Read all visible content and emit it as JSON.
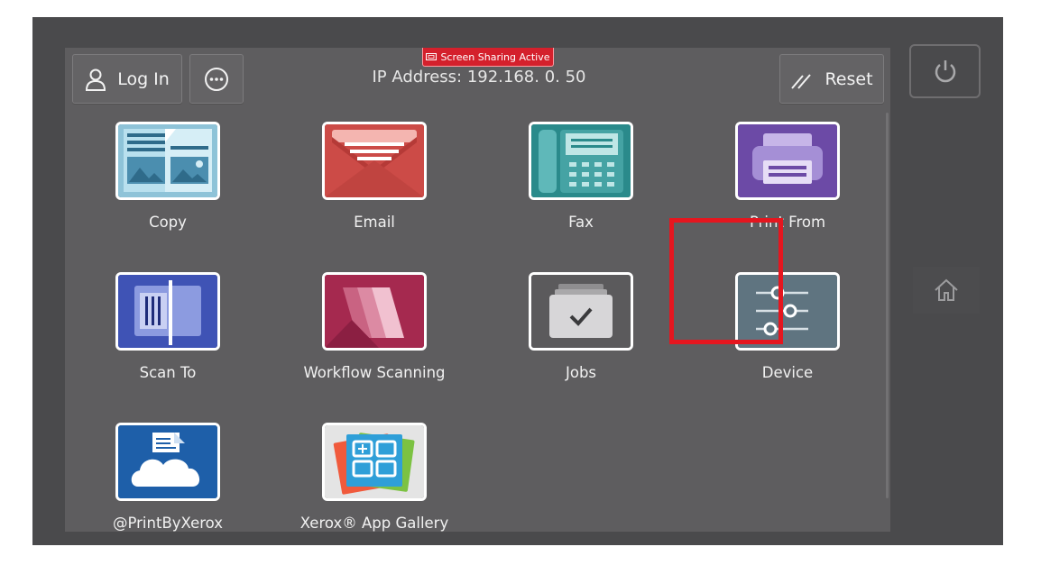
{
  "header": {
    "login_label": "Log In",
    "more_icon": "ellipsis-icon",
    "reset_label": "Reset",
    "banner_text": "Screen Sharing Active",
    "ip_text": "IP Address: 192.168. 0. 50"
  },
  "apps": [
    {
      "label": "Copy",
      "icon": "copy-icon"
    },
    {
      "label": "Email",
      "icon": "email-icon"
    },
    {
      "label": "Fax",
      "icon": "fax-icon"
    },
    {
      "label": "Print From",
      "icon": "printer-icon"
    },
    {
      "label": "Scan To",
      "icon": "scan-icon"
    },
    {
      "label": "Workflow Scanning",
      "icon": "workflow-icon"
    },
    {
      "label": "Jobs",
      "icon": "jobs-icon"
    },
    {
      "label": "Device",
      "icon": "sliders-icon"
    },
    {
      "label": "@PrintByXerox",
      "icon": "cloud-print-icon"
    },
    {
      "label": "Xerox® App Gallery",
      "icon": "app-gallery-icon"
    }
  ],
  "side_buttons": {
    "power_icon": "power-icon",
    "home_icon": "home-icon"
  },
  "colors": {
    "highlight": "#e5161f",
    "banner": "#d4202c",
    "screen_bg": "#5e5d5f"
  }
}
